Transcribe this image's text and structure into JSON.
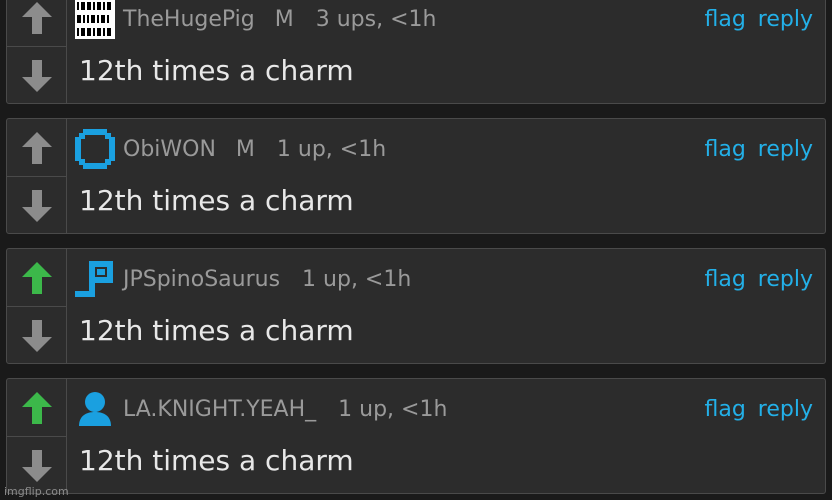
{
  "comments": [
    {
      "username": "TheHugePig",
      "mod_badge": "M",
      "ups": "3 ups, <1h",
      "text": "12th times a charm",
      "upvoted": false,
      "avatar": "binary-digits-icon",
      "flag_label": "flag",
      "reply_label": "reply"
    },
    {
      "username": "ObiWON",
      "mod_badge": "M",
      "ups": "1 up, <1h",
      "text": "12th times a charm",
      "upvoted": false,
      "avatar": "square-ring-icon",
      "flag_label": "flag",
      "reply_label": "reply"
    },
    {
      "username": "JPSpinoSaurus",
      "mod_badge": "",
      "ups": "1 up, <1h",
      "text": "12th times a charm",
      "upvoted": true,
      "avatar": "p-shape-icon",
      "flag_label": "flag",
      "reply_label": "reply"
    },
    {
      "username": "LA.KNIGHT.YEAH_",
      "mod_badge": "",
      "ups": "1 up, <1h",
      "text": "12th times a charm",
      "upvoted": true,
      "avatar": "user-silhouette-icon",
      "flag_label": "flag",
      "reply_label": "reply"
    }
  ],
  "colors": {
    "upvote_active": "#3cb84a",
    "vote_inactive": "#8c8c8c",
    "link": "#23b0e8",
    "avatar_blue": "#1aa0e0"
  },
  "watermark": "imgflip.com"
}
